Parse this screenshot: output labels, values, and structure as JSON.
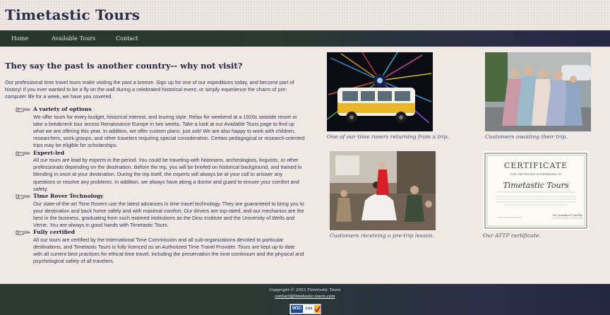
{
  "site": {
    "title": "Timetastic Tours"
  },
  "nav": {
    "items": [
      "Home",
      "Available Tours",
      "Contact"
    ]
  },
  "main": {
    "heading": "They say the past is another country-- why not visit?",
    "intro": "Our professional time travel tours make visiting the past a breeze. Sign up for one of our expeditions today, and become part of history! If you ever wanted to be a fly on the wall during a celebrated historical event, or simply experience the charm of pre-computer life for a week, we have you covered.",
    "features": [
      {
        "title": "A variety of options",
        "text": "We offer tours for every budget, historical interest, and touring style. Relax for weekend at a 1920s seaside resort or take a breakneck tour across Renaissance Europe in two weeks. Take a look at our Available Tours page to find up what we are offering this year. In addition, we offer custom plans: just ask! We are also happy to work with children, researchers, work groups, and other travelers requiring special consideration. Certain pedagogical or research-oriented trips may be eligible for scholarships."
      },
      {
        "title": "Expert-led",
        "text": "All our tours are lead by experts in the period. You could be traveling with historians, archeologists, linguists, or other professionals depending on the destination. Before the trip, you will be briefed on historical background, and trained in blending in once at your destination. During the trip itself, the experts will always be at your call to answer any questions or resolve any problems. In addition, we always have along a doctor and guard to ensure your comfort and safety."
      },
      {
        "title": "Time Rover Technology",
        "text": "Our state-of-the-art Time Rovers use the latest advances in time travel technology. They are guaranteed to bring you to your destination and back home safely and with maximal comfort. Our drivers are top-rated, and our mechanics are the best in the business, graduating from such estimed institutions as the Dino Institute and the University of Wells and Verne. You are always in good hands with Timetastic Tours."
      },
      {
        "title": "Fully certified",
        "text": "All our tours are certified by the International Time Commission and all sub-organizations devoted to particular destinations, and Timetastic Tours is fully licenced as an Authorized Time Travel Provider. Tours are kept up to date with all current best practices for ethical time travel, including the preservation the time continuum and the physical and psychological safety of all travelers."
      }
    ]
  },
  "gallery": [
    {
      "caption": "One of our time rovers returning from a trip.",
      "icon": "time-rover-bus-photo"
    },
    {
      "caption": "Customers awaiting their trip.",
      "icon": "customers-costume-photo"
    },
    {
      "caption": "Customers receiving a pre-trip lesson.",
      "icon": "lesson-photo"
    },
    {
      "caption": "Our ATTP certificate.",
      "icon": "certificate-photo"
    }
  ],
  "certificate": {
    "heading": "CERTIFICATE",
    "subheading": "THIS CERTIFICATE IS PRESENTED TO",
    "name": "Timetastic Tours",
    "signature": "Dr. Jennifer P. McFly"
  },
  "footer": {
    "copyright": "Copyright © 2053 Timetastic Tours",
    "contact": "contact@timetastic-tours.com",
    "badge_w3c": "W3C",
    "badge_css": "css"
  },
  "colors": {
    "page_bg": "#efe8e4",
    "title": "#2b2d49",
    "nav_dark_green": "#26392a",
    "nav_dark_blue": "#252745",
    "text": "#303657"
  }
}
